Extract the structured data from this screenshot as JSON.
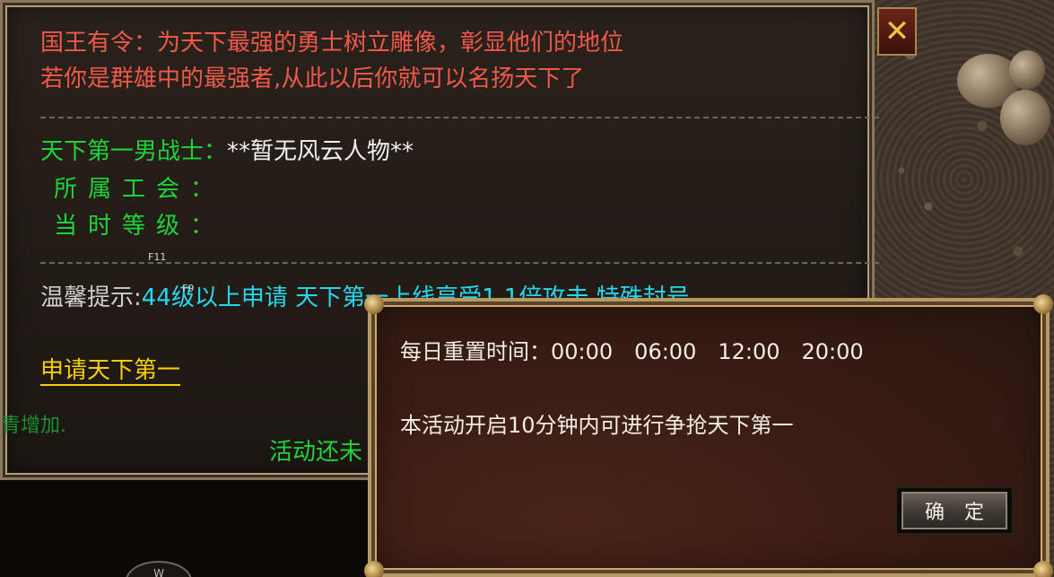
{
  "decree": {
    "line1": "国王有令：为天下最强的勇士树立雕像，彰显他们的地位",
    "line2": "若你是群雄中的最强者,从此以后你就可以名扬天下了"
  },
  "champion": {
    "label": "天下第一男战士：",
    "name": "**暂无风云人物**",
    "guild_label": "所属工会：",
    "guild_value": "",
    "level_label": "当时等级：",
    "level_value": ""
  },
  "hotkeys": {
    "f11": "F11",
    "f9": "F9"
  },
  "tip": {
    "label": "温馨提示:",
    "text": "44级以上申请 天下第一上线享受1.1倍攻击 特殊封号"
  },
  "apply_link": "申请天下第一",
  "side_text": "青增加.",
  "activity_text": "活动还未",
  "close_label": "✕",
  "dialog": {
    "reset_label": "每日重置时间：",
    "times": [
      "00:00",
      "06:00",
      "12:00",
      "20:00"
    ],
    "note": "本活动开启10分钟内可进行争抢天下第一",
    "confirm": "确定"
  },
  "compass_label": "W"
}
